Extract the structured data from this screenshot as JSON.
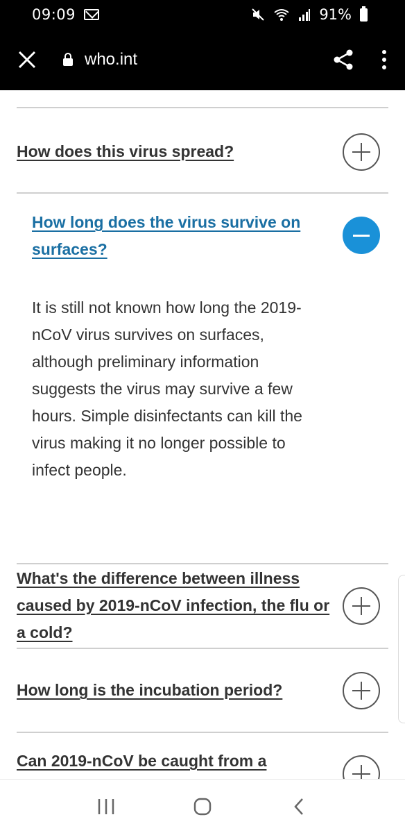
{
  "status_bar": {
    "time": "09:09",
    "battery": "91%",
    "icons": [
      "mail-icon",
      "mute-icon",
      "wifi-icon",
      "signal-icon",
      "battery-icon"
    ]
  },
  "browser": {
    "url": "who.int",
    "icons": [
      "close-icon",
      "lock-icon",
      "share-icon",
      "more-vert-icon"
    ]
  },
  "faq": [
    {
      "question": "How does this virus spread?",
      "expanded": false
    },
    {
      "question": "How long does the virus survive on surfaces?",
      "expanded": true,
      "answer": "It is still not known how long the 2019-nCoV virus survives on surfaces, although preliminary information suggests the virus may survive a few hours. Simple disinfectants can kill the virus making it no longer possible to infect people."
    },
    {
      "question": "What's the difference between illness caused by 2019-nCoV infection, the flu or a cold?",
      "expanded": false
    },
    {
      "question": "How long is the incubation period?",
      "expanded": false
    },
    {
      "question": "Can 2019-nCoV be caught from a",
      "expanded": false
    }
  ],
  "colors": {
    "active_link": "#1a6fa3",
    "active_toggle": "#1a91d8",
    "text": "#333333",
    "toolbar": "#000000"
  },
  "nav": {
    "icons": [
      "recent-apps-icon",
      "home-icon",
      "back-icon"
    ]
  }
}
